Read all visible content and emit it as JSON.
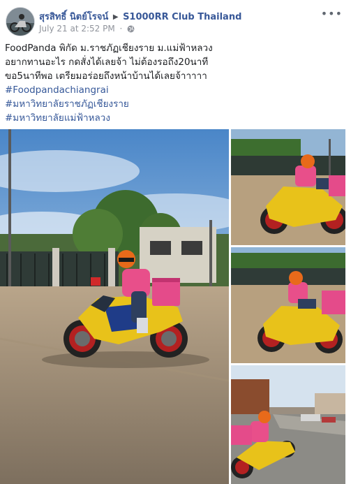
{
  "post": {
    "author": "สุรสิทธิ์ นิตย์โรจน์",
    "group": "S1000RR Club Thailand",
    "timestamp": "July 21 at 2:52 PM",
    "separator": "·",
    "more_label": "•••",
    "lines": [
      "FoodPanda พิกัด ม.ราชภัฏเชียงราย ม.แม่ฟ้าหลวง",
      "อยากทานอะไร กดสั่งได้เลยจ้า ไม่ต้องรอถึง20นาที",
      "ขอ5นาทีพอ เตรียมอร่อยถึงหน้าบ้านได้เลยจ้าาาาา"
    ],
    "hashtags": [
      "#Foodpandachiangrai",
      "#มหาวิทยาลัยราชภัฏเชียงราย",
      "#มหาวิทยาลัยแม่ฟ้าหลวง"
    ]
  },
  "colors": {
    "link": "#385898",
    "hashtag": "#365899",
    "meta": "#90949c",
    "bike_yellow": "#e8c21a",
    "jacket_pink": "#e84f8a"
  },
  "icons": [
    "globe-icon",
    "more-options-icon",
    "arrow-right-icon",
    "avatar"
  ]
}
